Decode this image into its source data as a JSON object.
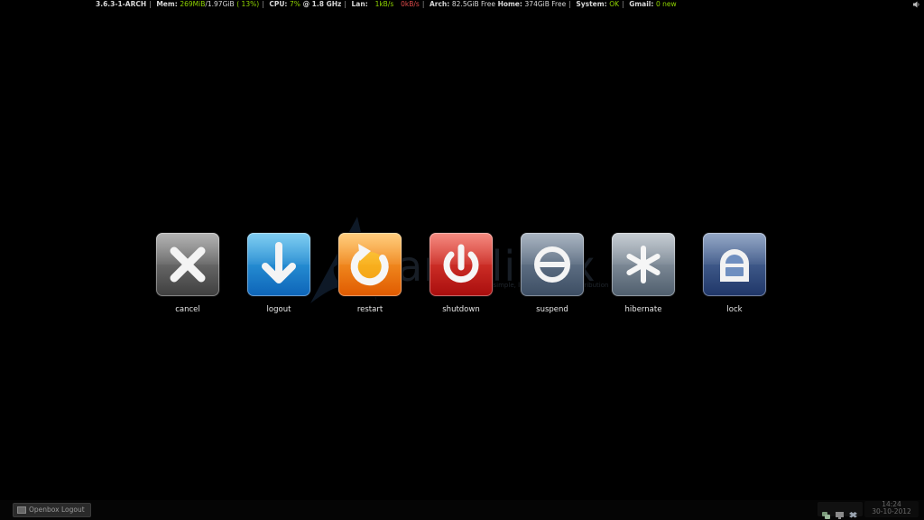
{
  "statusbar": {
    "kernel": "3.6.3-1-ARCH",
    "mem_label": "Mem:",
    "mem_used": "269MiB",
    "mem_total": "/1.97GiB",
    "mem_percent": "( 13%)",
    "cpu_label": "CPU:",
    "cpu_percent": "7%",
    "cpu_freq": "@ 1.8 GHz",
    "lan_label": "Lan:",
    "lan_down": "1kB/s",
    "lan_up": "0kB/s",
    "arch_label": "Arch:",
    "arch_free": "82.5GiB Free",
    "home_label": "Home:",
    "home_free": "374GiB Free",
    "system_label": "System:",
    "system_status": "OK",
    "gmail_label": "Gmail:",
    "gmail_status": "0 new",
    "sep": "|"
  },
  "watermark": {
    "text": "archlinux",
    "tagline": "a simple, lightweight linux distribution"
  },
  "buttons": [
    {
      "label": "cancel",
      "icon": "cancel-icon"
    },
    {
      "label": "logout",
      "icon": "logout-icon"
    },
    {
      "label": "restart",
      "icon": "restart-icon"
    },
    {
      "label": "shutdown",
      "icon": "shutdown-icon"
    },
    {
      "label": "suspend",
      "icon": "suspend-icon"
    },
    {
      "label": "hibernate",
      "icon": "hibernate-icon"
    },
    {
      "label": "lock",
      "icon": "lock-icon"
    }
  ],
  "panel": {
    "task_label": "Openbox Logout",
    "clock_time": "14:24",
    "clock_date": "30-10-2012"
  }
}
